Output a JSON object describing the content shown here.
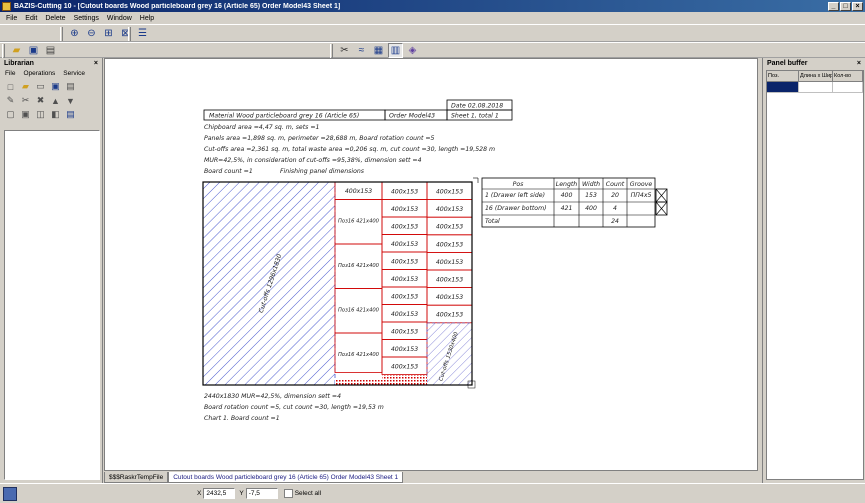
{
  "window": {
    "title": "BAZIS-Cutting 10 - [Cutout boards Wood particleboard grey 16 (Article 65) Order Model43 Sheet 1]"
  },
  "menu": [
    "File",
    "Edit",
    "Delete",
    "Settings",
    "Window",
    "Help"
  ],
  "librarian": {
    "title": "Librarian",
    "close": "×",
    "menu": [
      "File",
      "Operations",
      "Service"
    ]
  },
  "panel_buffer": {
    "title": "Panel buffer",
    "close": "×",
    "columns": [
      "Поз.",
      "Длина x Шир.",
      "Кол-во"
    ]
  },
  "drawing": {
    "date": "Date 02.08.2018",
    "material": "Material Wood particleboard grey 16 (Article 65)",
    "order": "Order Model43",
    "sheet": "Sheet 1, total 1",
    "info_lines": [
      "Chipboard area =4,47 sq. m, sets =1",
      "Panels area =1,898 sq. m, perimeter =28,688 m, Board rotation count =5",
      "Cut-offs area =2,361 sq. m, total waste area =0,206 sq. m, cut count =30, length =19,528 m",
      "MUR=42,5%, in consideration of cut-offs =95,38%, dimension sett  =4"
    ],
    "board_count": "Board count =1",
    "finishing": "Finishing panel dimensions",
    "cutoff_large": "Cut-offs 1296x1830",
    "cutoff_small": "Cut-offs 1530x400",
    "piece_label": "400x153",
    "mid_label": "Поз16  421x400",
    "footer_lines": [
      "2440x1830 MUR=42,5%, dimension sett  =4",
      "Board rotation count =5, cut count =30, length =19,53 m",
      "Chart 1. Board count =1"
    ],
    "parts_table": {
      "headers": [
        "Pos",
        "Length",
        "Width",
        "Count",
        "Groove"
      ],
      "rows": [
        [
          "1 (Drawer left side)",
          "400",
          "153",
          "20",
          "ПП4х5"
        ],
        [
          "16 (Drawer bottom)",
          "421",
          "400",
          "4",
          ""
        ],
        [
          "Total",
          "",
          "",
          "24",
          ""
        ]
      ]
    }
  },
  "tabs": [
    {
      "label": "$$$RaskrTempFile",
      "active": false
    },
    {
      "label": "Cutout boards Wood particleboard grey 16 (Article 65) Order Model43 Sheet 1",
      "active": true
    }
  ],
  "status": {
    "x_label": "X",
    "x_value": "2432,5",
    "y_label": "Y",
    "y_value": "-7,5",
    "select_all": "Select all"
  },
  "colors": {
    "hatch": "#4a5acf",
    "cut_lines": "#d00000",
    "title_bar": "#0a246a"
  }
}
